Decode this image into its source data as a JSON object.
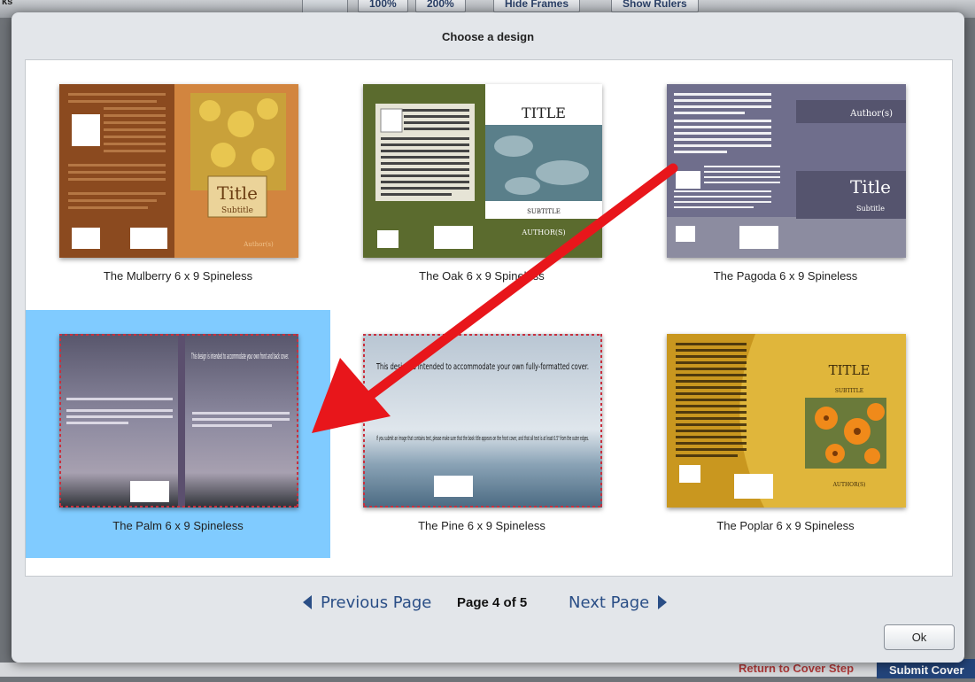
{
  "background": {
    "corner_label": "ks",
    "zoom_100": "100%",
    "zoom_200": "200%",
    "hide_frames": "Hide Frames",
    "show_rulers": "Show Rulers",
    "return_label": "Return to Cover Step",
    "submit_label": "Submit Cover"
  },
  "dialog": {
    "title": "Choose a design",
    "designs": [
      {
        "label": "The Mulberry 6 x 9 Spineless",
        "title": "Title",
        "subtitle": "Subtitle",
        "author": "Author(s)"
      },
      {
        "label": "The Oak 6 x 9 Spineless",
        "title": "TITLE",
        "subtitle": "SUBTITLE",
        "author": "AUTHOR(S)"
      },
      {
        "label": "The Pagoda 6 x 9 Spineless",
        "title": "Title",
        "subtitle": "Subtitle",
        "author": "Author(s)"
      },
      {
        "label": "The Palm 6 x 9 Spineless",
        "text_front": "This design is intended to accommodate your own front and back cover.",
        "text_back": "Upload your back cover image here.",
        "selected": true
      },
      {
        "label": "The Pine 6 x 9 Spineless",
        "text_main": "This design is intended to accommodate your own fully-formatted cover.",
        "text_sub": "If you submit an image that contains text, please make sure that the book title appears on the front cover, and that all text is at least 0.5\" from the outer edges."
      },
      {
        "label": "The Poplar 6 x 9 Spineless",
        "title": "TITLE",
        "subtitle": "SUBTITLE",
        "author": "AUTHOR(S)"
      }
    ],
    "pager": {
      "previous": "Previous Page",
      "page_info": "Page 4 of 5",
      "next": "Next Page"
    },
    "ok": "Ok"
  },
  "colors": {
    "selection": "#80cbff",
    "annotation_arrow": "#e8161b",
    "link": "#2a4e86"
  }
}
